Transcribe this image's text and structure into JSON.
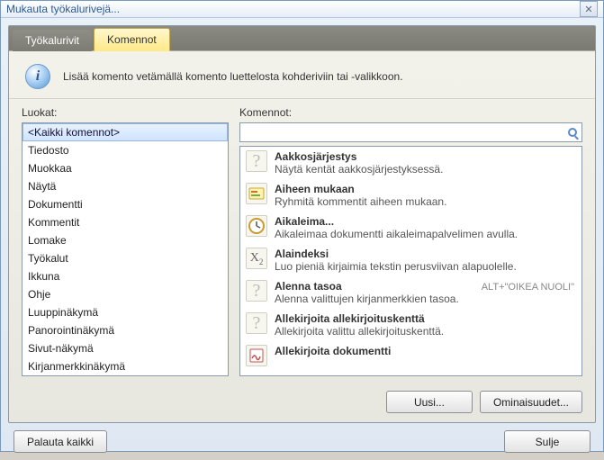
{
  "window": {
    "title": "Mukauta työkalurivejä..."
  },
  "tabs": {
    "inactive": "Työkalurivit",
    "active": "Komennot"
  },
  "info": "Lisää komento vetämällä komento luettelosta kohderiviin tai -valikkoon.",
  "labels": {
    "categories": "Luokat:",
    "commands": "Komennot:"
  },
  "search": {
    "placeholder": ""
  },
  "categories": [
    "<Kaikki komennot>",
    "Tiedosto",
    "Muokkaa",
    "Näytä",
    "Dokumentti",
    "Kommentit",
    "Lomake",
    "Työkalut",
    "Ikkuna",
    "Ohje",
    "Luuppinäkymä",
    "Panorointinäkymä",
    "Sivut-näkymä",
    "Kirjanmerkkinäkymä"
  ],
  "selectedCategoryIndex": 0,
  "commands": [
    {
      "icon": "question",
      "title": "Aakkosjärjestys",
      "desc": "Näytä kentät aakkosjärjestyksessä.",
      "shortcut": ""
    },
    {
      "icon": "topic",
      "title": "Aiheen mukaan",
      "desc": "Ryhmitä kommentit aiheen mukaan.",
      "shortcut": ""
    },
    {
      "icon": "clock",
      "title": "Aikaleima...",
      "desc": "Aikaleimaa dokumentti aikaleimapalvelimen avulla.",
      "shortcut": ""
    },
    {
      "icon": "x2",
      "title": "Alaindeksi",
      "desc": "Luo pieniä kirjaimia tekstin perusviivan alapuolelle.",
      "shortcut": ""
    },
    {
      "icon": "question",
      "title": "Alenna tasoa",
      "desc": "Alenna valittujen kirjanmerkkien tasoa.",
      "shortcut": "ALT+\"OIKEA NUOLI\""
    },
    {
      "icon": "question",
      "title": "Allekirjoita allekirjoituskenttä",
      "desc": "Allekirjoita valittu allekirjoituskenttä.",
      "shortcut": ""
    },
    {
      "icon": "sign",
      "title": "Allekirjoita dokumentti",
      "desc": "",
      "shortcut": ""
    }
  ],
  "buttons": {
    "new": "Uusi...",
    "properties": "Ominaisuudet...",
    "restore": "Palauta kaikki",
    "close": "Sulje"
  }
}
